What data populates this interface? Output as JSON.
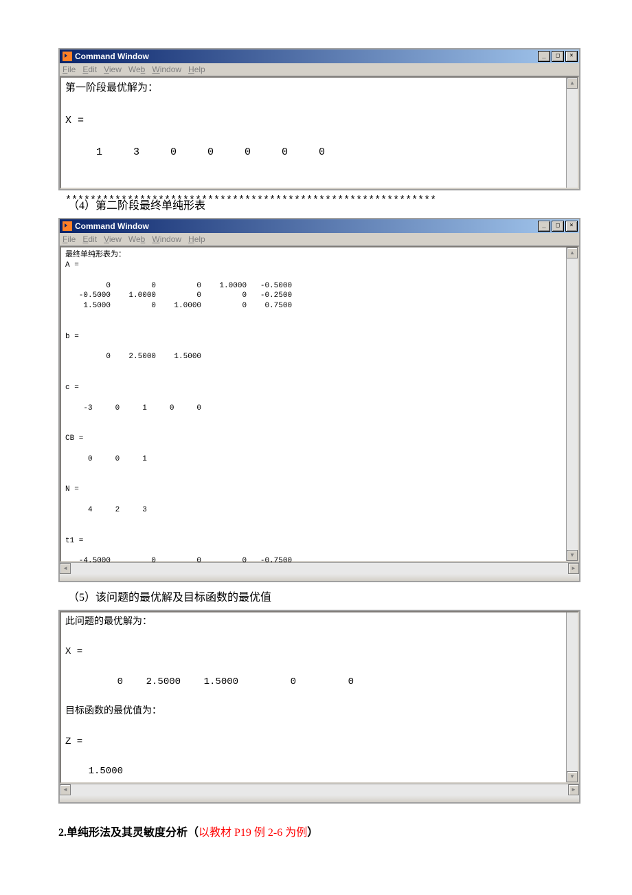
{
  "win1": {
    "title": "Command Window",
    "menus": [
      "File",
      "Edit",
      "View",
      "Web",
      "Window",
      "Help"
    ],
    "body": "第一阶段最优解为：\n\nX =\n\n     1     3     0     0     0     0     0\n\n\n************************************************************"
  },
  "caption4": "（4）第二阶段最终单纯形表",
  "win2": {
    "title": "Command Window",
    "menus": [
      "File",
      "Edit",
      "View",
      "Web",
      "Window",
      "Help"
    ],
    "body": "最终单纯形表为：\nA =\n\n         0         0         0    1.0000   -0.5000\n   -0.5000    1.0000         0         0   -0.2500\n    1.5000         0    1.0000         0    0.7500\n\n\nb =\n\n         0    2.5000    1.5000\n\n\nc =\n\n    -3     0     1     0     0\n\n\nCB =\n\n     0     0     1\n\n\nN =\n\n     4     2     3\n\n\nt1 =\n\n   -4.5000         0         0         0   -0.7500"
  },
  "caption5": "（5）该问题的最优解及目标函数的最优值",
  "panel3": {
    "body": "此问题的最优解为：\n\nX =\n\n         0    2.5000    1.5000         0         0\n\n目标函数的最优值为：\n\nZ =\n\n    1.5000\n"
  },
  "heading2_pre": "2.单纯形法及其灵敏度分析（",
  "heading2_red": "以教材 P19 例 2-6 为例",
  "heading2_post": "）",
  "chart_data": {
    "type": "table",
    "phase1_X": [
      1,
      3,
      0,
      0,
      0,
      0,
      0
    ],
    "phase2_A": [
      [
        0,
        0,
        0,
        1.0,
        -0.5
      ],
      [
        -0.5,
        1.0,
        0,
        0,
        -0.25
      ],
      [
        1.5,
        0,
        1.0,
        0,
        0.75
      ]
    ],
    "phase2_b": [
      0,
      2.5,
      1.5
    ],
    "phase2_c": [
      -3,
      0,
      1,
      0,
      0
    ],
    "phase2_CB": [
      0,
      0,
      1
    ],
    "phase2_N": [
      4,
      2,
      3
    ],
    "phase2_t1": [
      -4.5,
      0,
      0,
      0,
      -0.75
    ],
    "final_X": [
      0,
      2.5,
      1.5,
      0,
      0
    ],
    "final_Z": 1.5
  }
}
